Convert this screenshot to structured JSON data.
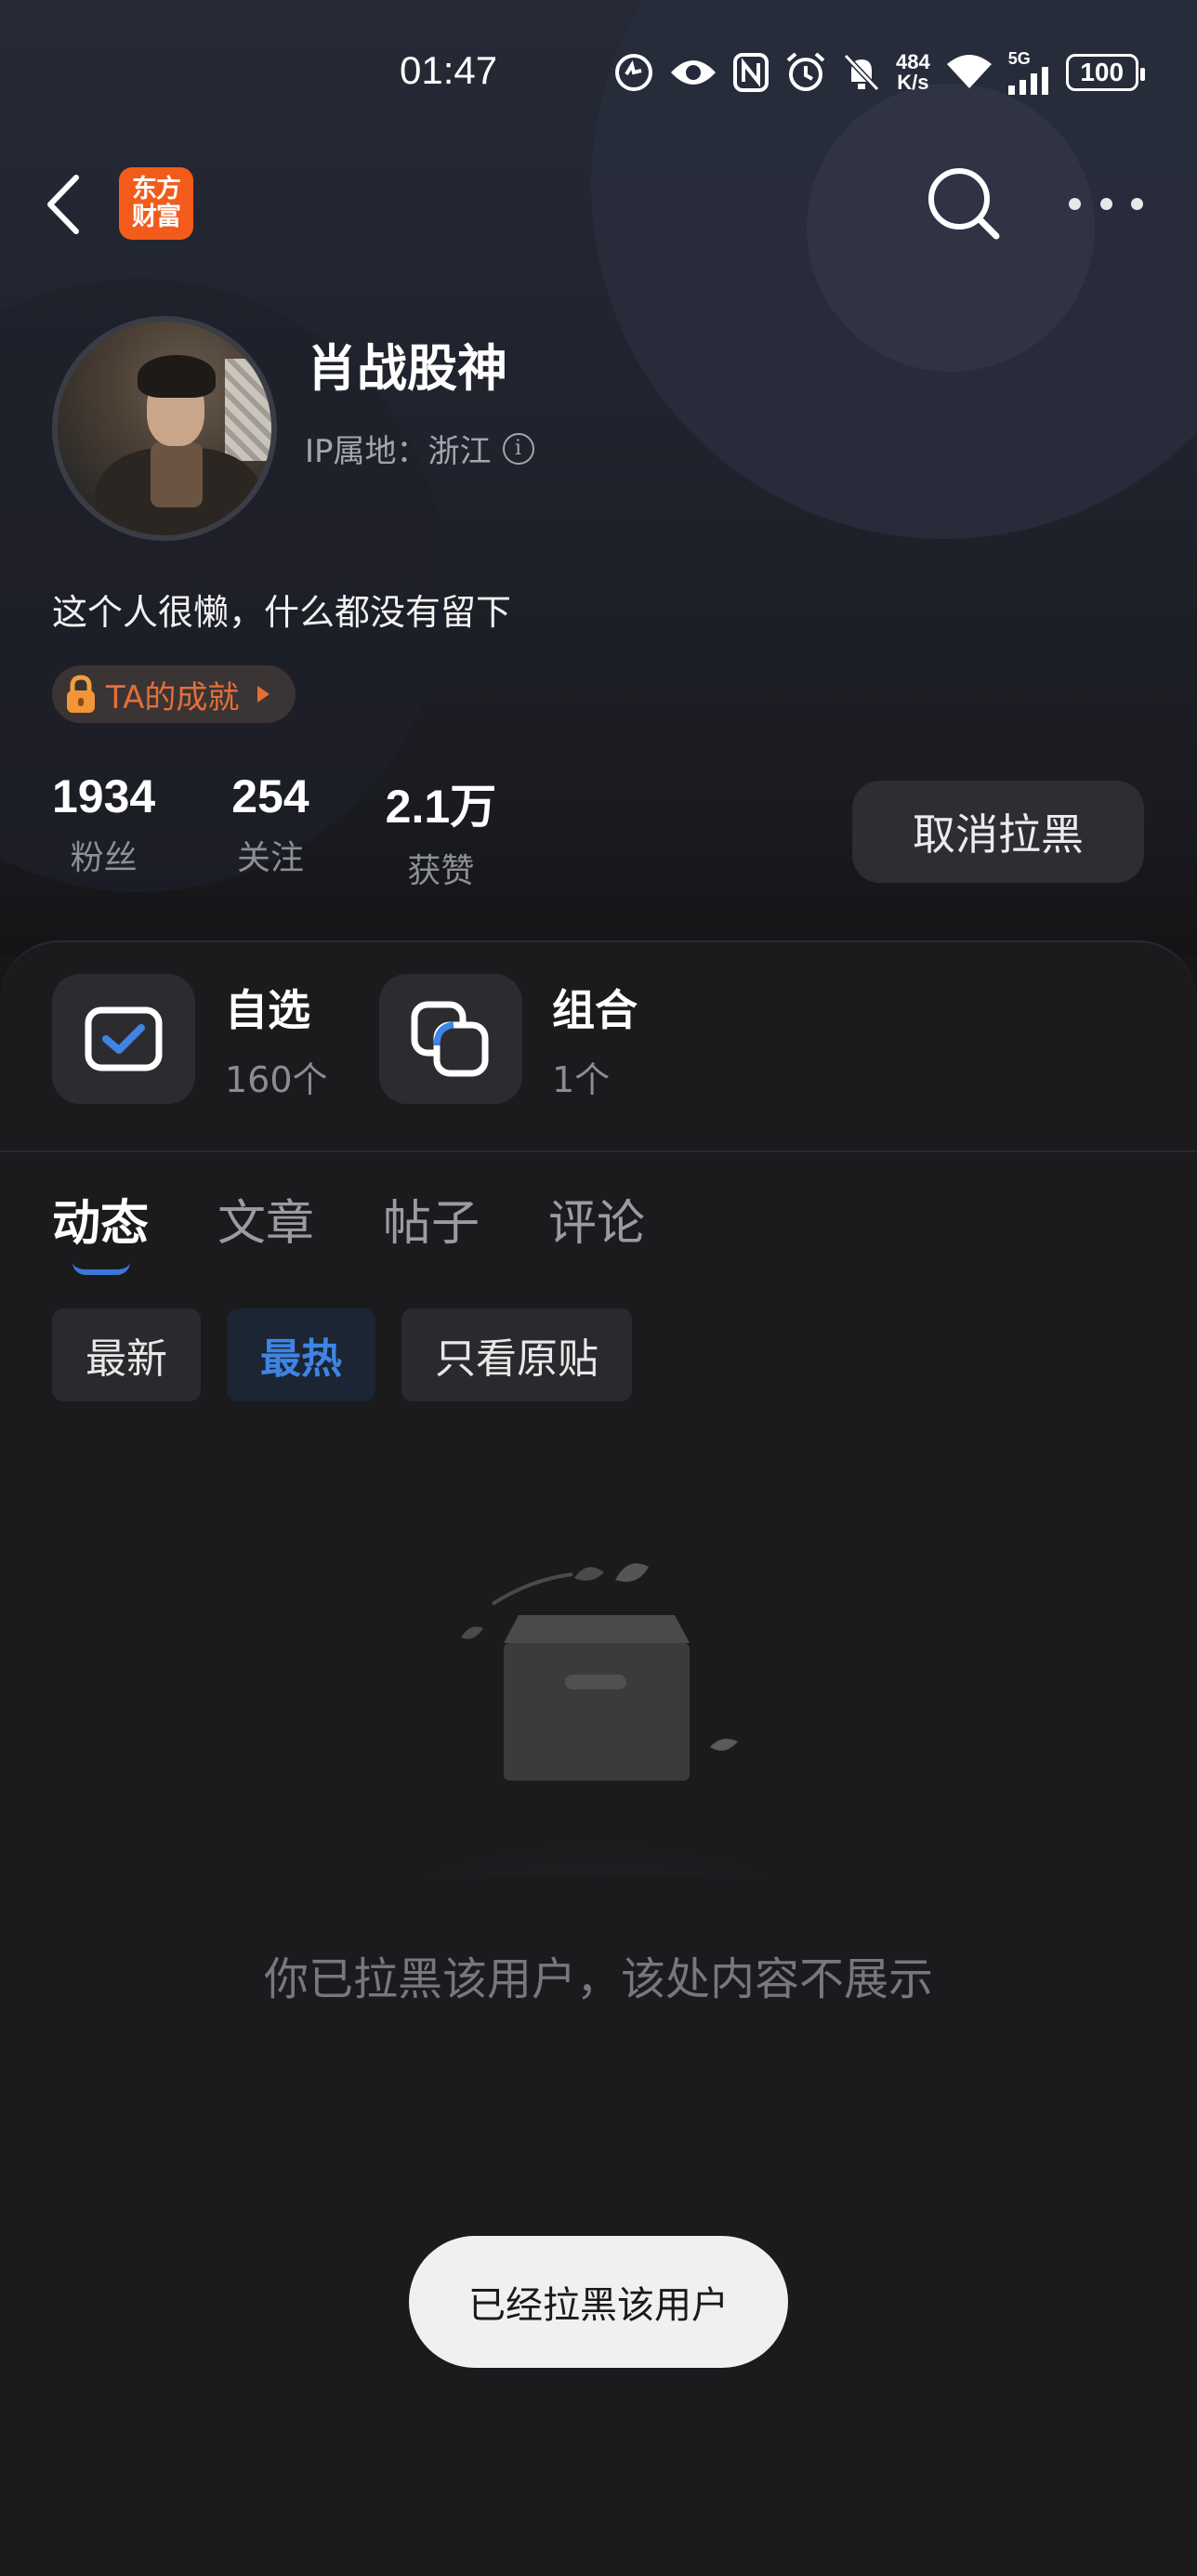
{
  "status_bar": {
    "time": "01:47",
    "speed_value": "484",
    "speed_unit": "K/s",
    "network": "5G",
    "battery": "100",
    "icons": [
      "nfc-shield-icon",
      "eye-icon",
      "nfc-icon",
      "alarm-icon",
      "mute-icon",
      "wifi-icon",
      "signal-icon",
      "battery-icon"
    ]
  },
  "nav": {
    "logo_line1": "东方",
    "logo_line2": "财富",
    "back_icon": "chevron-left-icon",
    "search_icon": "search-icon",
    "more_icon": "more-horizontal-icon"
  },
  "profile": {
    "name": "肖战股神",
    "ip_location": "IP属地：浙江",
    "bio": "这个人很懒，什么都没有留下",
    "achievement": "TA的成就",
    "stats": [
      {
        "value": "1934",
        "label": "粉丝"
      },
      {
        "value": "254",
        "label": "关注"
      },
      {
        "value": "2.1万",
        "label": "获赞"
      }
    ],
    "unblock_button": "取消拉黑"
  },
  "features": [
    {
      "title": "自选",
      "sub": "160个"
    },
    {
      "title": "组合",
      "sub": "1个"
    }
  ],
  "tabs": [
    "动态",
    "文章",
    "帖子",
    "评论"
  ],
  "active_tab": "动态",
  "filters": [
    "最新",
    "最热",
    "只看原贴"
  ],
  "active_filter": "最热",
  "empty_message": "你已拉黑该用户，该处内容不展示",
  "toast": "已经拉黑该用户",
  "colors": {
    "accent_blue": "#3f84e4",
    "brand_orange": "#f35b1a",
    "achievement_orange": "#e36f38",
    "background": "#171719"
  }
}
